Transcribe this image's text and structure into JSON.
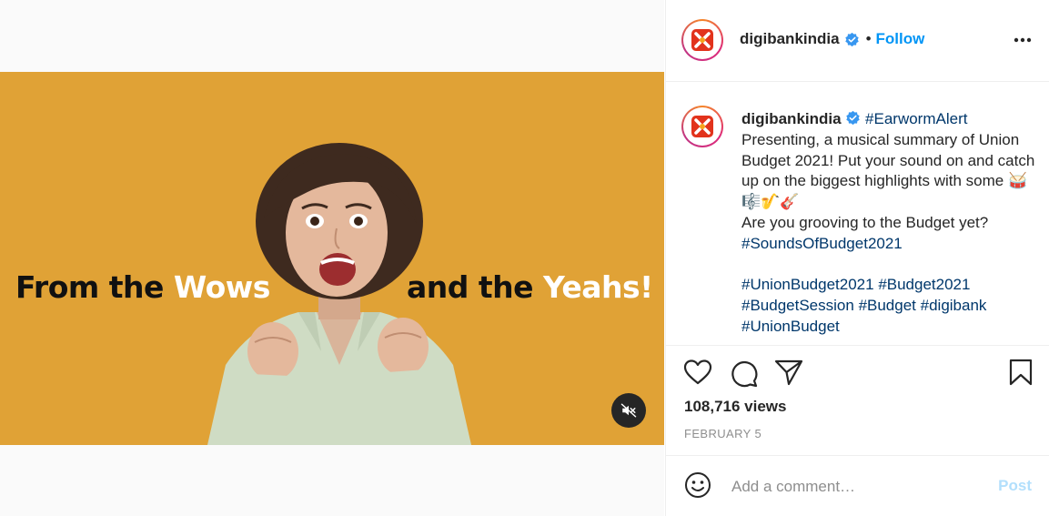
{
  "account": {
    "username": "digibankindia",
    "follow_label": "Follow",
    "separator": "•"
  },
  "video": {
    "text_left_prefix": "From the ",
    "text_left_highlight": "Wows",
    "text_right_prefix": "and the ",
    "text_right_highlight": "Yeahs!",
    "background_color": "#e0a236",
    "mute_icon": "speaker-muted-icon"
  },
  "caption": {
    "username": "digibankindia",
    "hashtag_intro": "#EarwormAlert",
    "line1": "Presenting, a musical summary of Union Budget 2021! Put your sound on and catch up on the biggest highlights with some ",
    "emojis": "🥁🎼🎷🎸",
    "line2": "Are you grooving to the Budget yet?",
    "tag_sounds": "#SoundsOfBudget2021",
    "tags": [
      "#UnionBudget2021",
      "#Budget2021",
      "#BudgetSession",
      "#Budget",
      "#digibank",
      "#UnionBudget"
    ]
  },
  "stats": {
    "views": "108,716 views",
    "date": "FEBRUARY 5"
  },
  "comment": {
    "placeholder": "Add a comment…",
    "post_label": "Post"
  },
  "colors": {
    "link": "#0095f6",
    "hashtag": "#00376b",
    "muted": "#8e8e8e",
    "post_disabled": "#b2dffc"
  }
}
